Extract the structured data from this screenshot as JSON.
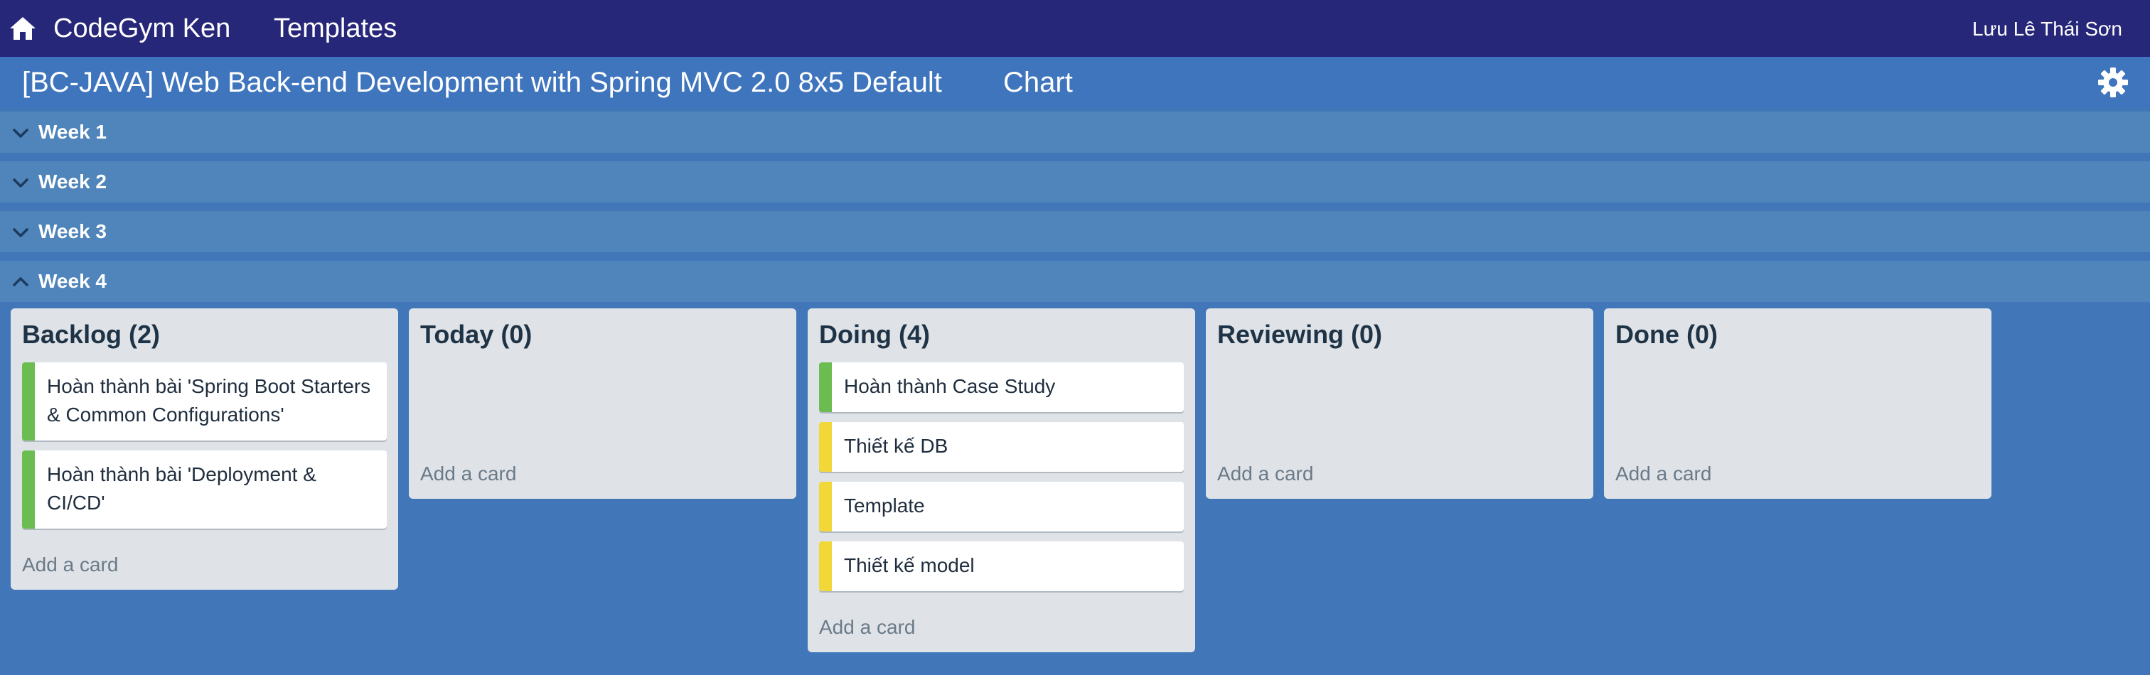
{
  "nav": {
    "brand": "CodeGym Ken",
    "templates": "Templates",
    "user": "Lưu Lê Thái Sơn",
    "bg_color": "#27277a"
  },
  "board": {
    "title": "[BC-JAVA] Web Back-end Development with Spring MVC 2.0 8x5 Default",
    "chart_link": "Chart"
  },
  "weeks": [
    {
      "label": "Week 1",
      "expanded": false
    },
    {
      "label": "Week 2",
      "expanded": false
    },
    {
      "label": "Week 3",
      "expanded": false
    },
    {
      "label": "Week 4",
      "expanded": true
    }
  ],
  "lists": [
    {
      "title": "Backlog (2)",
      "cards": [
        {
          "text": "Hoàn thành bài 'Spring Boot Starters & Common Configurations'",
          "label_color": "#6cbd51"
        },
        {
          "text": "Hoàn thành bài 'Deployment & CI/CD'",
          "label_color": "#6cbd51"
        }
      ],
      "add_card": "Add a card"
    },
    {
      "title": "Today (0)",
      "cards": [],
      "add_card": "Add a card"
    },
    {
      "title": "Doing (4)",
      "cards": [
        {
          "text": "Hoàn thành Case Study",
          "label_color": "#6cbd51"
        },
        {
          "text": "Thiết kế DB",
          "label_color": "#f2d738"
        },
        {
          "text": "Template",
          "label_color": "#f2d738"
        },
        {
          "text": "Thiết kế model",
          "label_color": "#f2d738"
        }
      ],
      "add_card": "Add a card"
    },
    {
      "title": "Reviewing (0)",
      "cards": [],
      "add_card": "Add a card"
    },
    {
      "title": "Done (0)",
      "cards": [],
      "add_card": "Add a card"
    }
  ],
  "icons": {
    "home": "home-icon",
    "settings": "gear-icon",
    "collapsed": "chevron-down-icon",
    "expanded": "chevron-up-icon"
  },
  "colors": {
    "board_bg": "#4177b9",
    "week_row_bg": "#4f85ba",
    "list_bg": "#dfe3e7",
    "label_green": "#6cbd51",
    "label_yellow": "#f2d738"
  }
}
